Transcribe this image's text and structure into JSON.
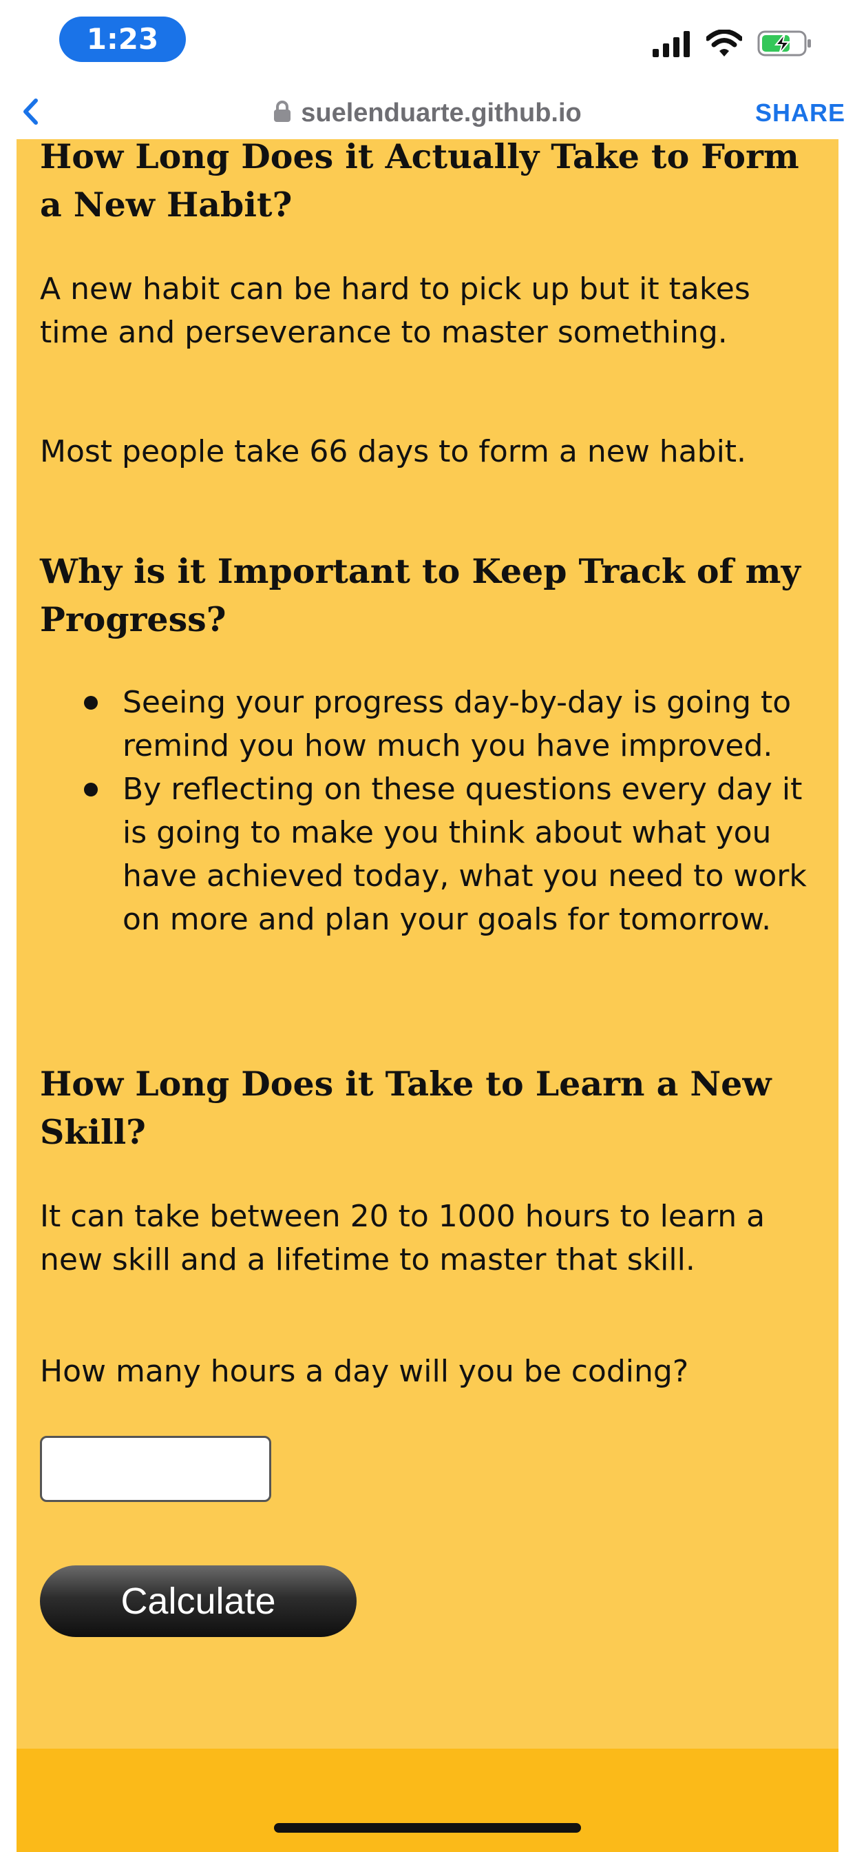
{
  "status_bar": {
    "time": "1:23",
    "icons": [
      "signal-bars-icon",
      "wifi-icon",
      "battery-charging-icon"
    ]
  },
  "browser": {
    "back_icon": "chevron-left-icon",
    "lock_icon": "lock-icon",
    "url": "suelenduarte.github.io",
    "share_label": "SHARE",
    "accent_color": "#1a73e8"
  },
  "content": {
    "habit_heading": "How Long Does it Actually Take to Form a New Habit?",
    "habit_paragraph_1": "A new habit can be hard to pick up but it takes time and perseverance to master something.",
    "habit_paragraph_2": "Most people take 66 days to form a new habit.",
    "progress_heading": "Why is it Important to Keep Track of my Progress?",
    "progress_items": [
      "Seeing your progress day-by-day is going to remind you how much you have improved.",
      "By reflecting on these questions every day it is going to make you think about what you have achieved today, what you need to work on more and plan your goals for tomorrow."
    ],
    "skill_heading": "How Long Does it Take to Learn a New Skill?",
    "skill_paragraph": "It can take between 20 to 1000 hours to learn a new skill and a lifetime to master that skill.",
    "question_label": "How many hours a day will you be coding?",
    "hours_input_value": "",
    "calculate_label": "Calculate"
  },
  "colors": {
    "page_background": "#fccb52",
    "footer_background": "#fbba19",
    "button_background": "#1f1f1f",
    "text": "#111111"
  }
}
